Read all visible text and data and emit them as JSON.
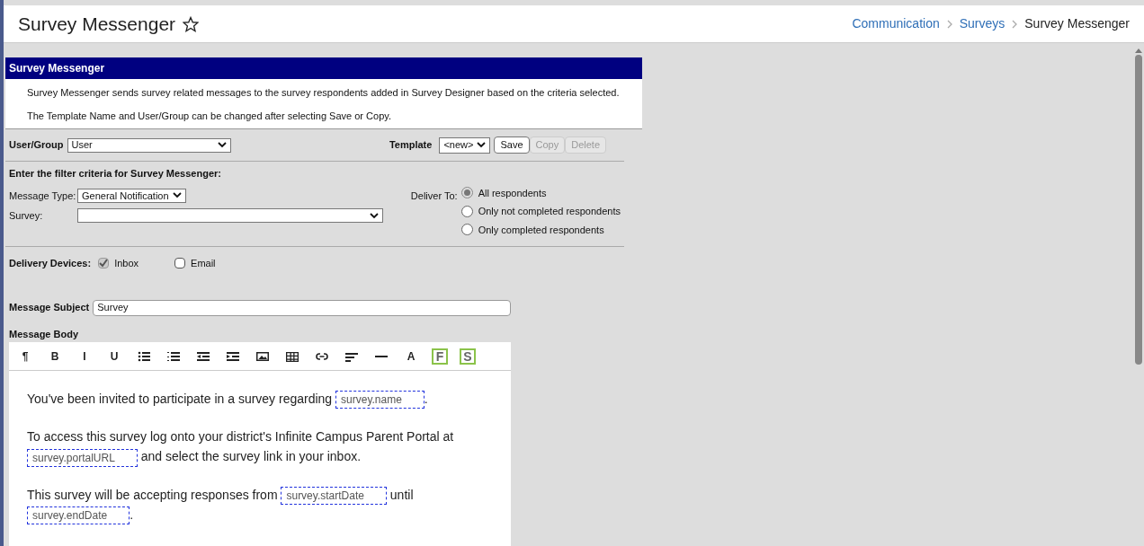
{
  "header": {
    "title": "Survey Messenger",
    "starred": false,
    "breadcrumb": [
      {
        "label": "Communication",
        "link": true
      },
      {
        "label": "Surveys",
        "link": true
      },
      {
        "label": "Survey Messenger",
        "link": false
      }
    ]
  },
  "panel": {
    "title": "Survey Messenger",
    "info": [
      "Survey Messenger sends survey related messages to the survey respondents added in Survey Designer based on the criteria selected.",
      "The Template Name and User/Group can be changed after selecting Save or Copy."
    ]
  },
  "user_group": {
    "label": "User/Group",
    "value": "User"
  },
  "template": {
    "label": "Template",
    "value": "<new>",
    "buttons": [
      {
        "label": "Save",
        "disabled": false
      },
      {
        "label": "Copy",
        "disabled": true
      },
      {
        "label": "Delete",
        "disabled": true
      }
    ]
  },
  "filter_heading": "Enter the filter criteria for Survey Messenger:",
  "message_type": {
    "label": "Message Type:",
    "value": "General Notification"
  },
  "survey": {
    "label": "Survey:"
  },
  "deliver_to": {
    "label": "Deliver To:",
    "options": [
      {
        "label": "All respondents",
        "selected": true
      },
      {
        "label": "Only not completed respondents",
        "selected": false
      },
      {
        "label": "Only completed respondents",
        "selected": false
      }
    ]
  },
  "delivery_devices": {
    "label": "Delivery Devices:",
    "options": [
      {
        "label": "Inbox",
        "checked": true
      },
      {
        "label": "Email",
        "checked": false
      }
    ]
  },
  "subject": {
    "label": "Message Subject",
    "value": "Survey"
  },
  "body": {
    "label": "Message Body",
    "toolbar": [
      {
        "kind": "glyph",
        "text": "¶"
      },
      {
        "kind": "glyph",
        "text": "B"
      },
      {
        "kind": "glyph",
        "text": "I"
      },
      {
        "kind": "glyph",
        "text": "U"
      },
      {
        "kind": "bullets"
      },
      {
        "kind": "numbers"
      },
      {
        "kind": "outdent"
      },
      {
        "kind": "indent"
      },
      {
        "kind": "image"
      },
      {
        "kind": "table"
      },
      {
        "kind": "link"
      },
      {
        "kind": "align"
      },
      {
        "kind": "rule"
      },
      {
        "kind": "glyph",
        "text": "A"
      },
      {
        "kind": "boxed",
        "text": "F"
      },
      {
        "kind": "boxed",
        "text": "S"
      }
    ],
    "paragraphs": [
      [
        {
          "kind": "text",
          "text": "You've been invited to participate in a survey regarding "
        },
        {
          "kind": "field",
          "text": "survey.name"
        },
        {
          "kind": "text",
          "text": "."
        }
      ],
      [
        {
          "kind": "text",
          "text": "To access this survey log onto your district's Infinite Campus Parent Portal at "
        },
        {
          "kind": "field",
          "text": "survey.portalURL"
        },
        {
          "kind": "text",
          "text": " and select the survey link in your inbox."
        }
      ],
      [
        {
          "kind": "text",
          "text": "This survey will be accepting responses from "
        },
        {
          "kind": "field",
          "text": "survey.startDate"
        },
        {
          "kind": "text",
          "text": " until "
        },
        {
          "kind": "field",
          "text": "survey.endDate"
        },
        {
          "kind": "text",
          "text": "."
        }
      ]
    ]
  }
}
